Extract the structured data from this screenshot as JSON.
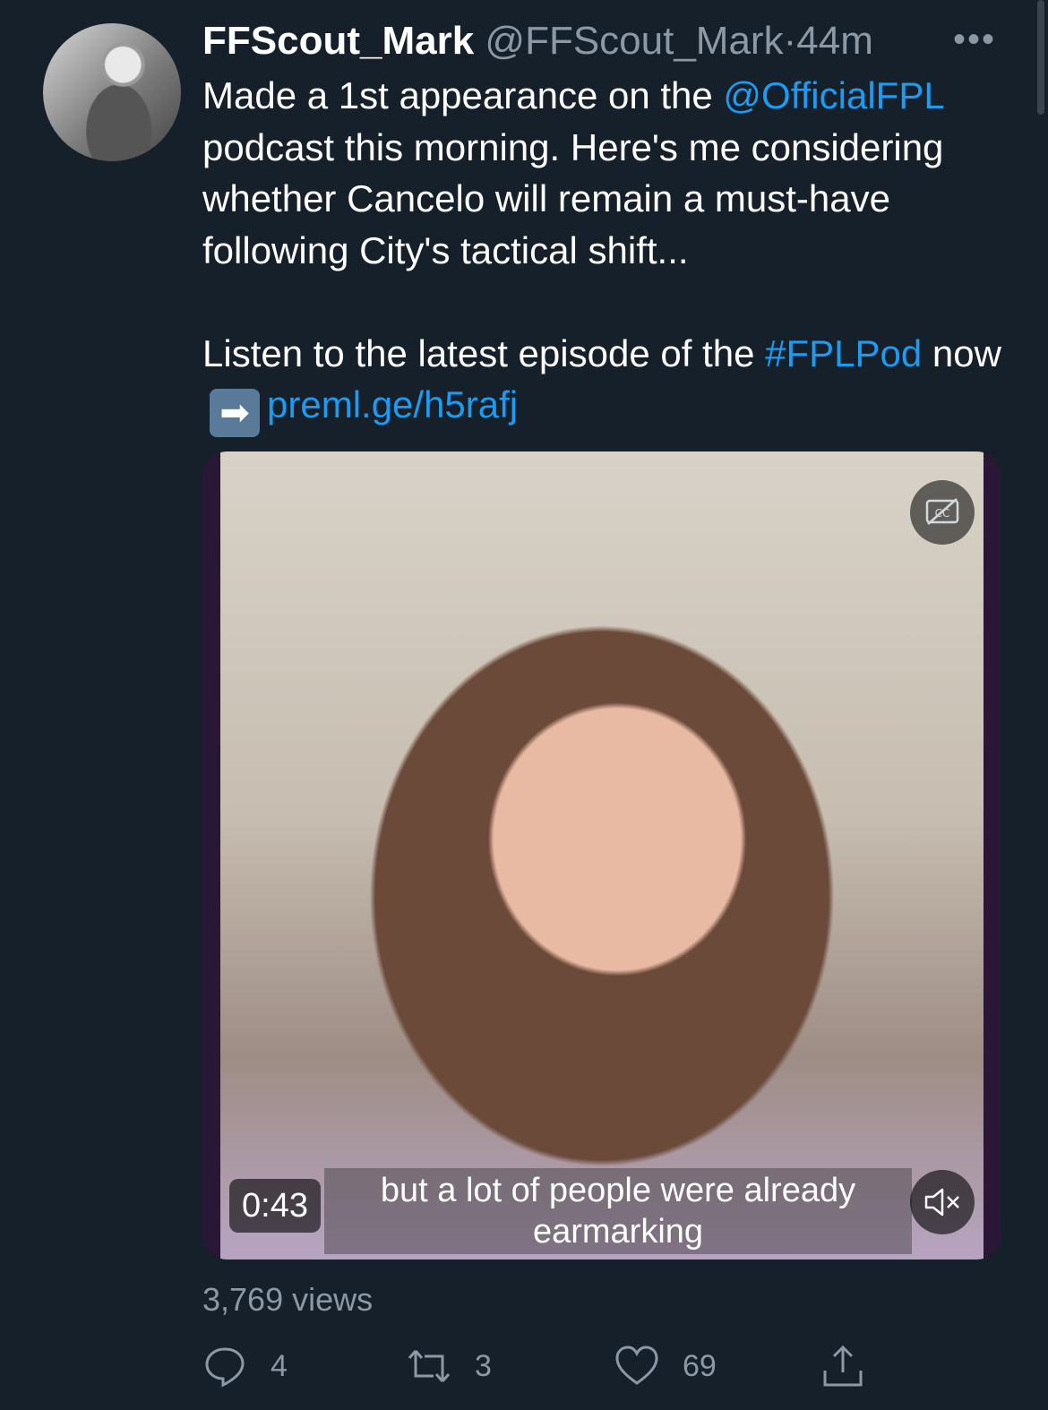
{
  "tweet": {
    "author_name": "FFScout_Mark",
    "handle": "@FFScout_Mark",
    "separator": "·",
    "time": "44m",
    "more_label": "•••",
    "text_line1_prefix": "Made a 1st appearance on the ",
    "mention": "@OfficialFPL",
    "text_line1_rest": " podcast this morning. Here's me considering whether Cancelo will remain a must-have following City's tactical shift...",
    "text_line2_prefix": "Listen to the latest episode of the ",
    "hashtag": "#FPLPod",
    "text_line2_now": " now",
    "arrow_emoji": "➡",
    "url": "preml.ge/h5rafj"
  },
  "media": {
    "timestamp": "0:43",
    "caption": "but a lot of people were already earmarking",
    "cc_icon": "cc-off-icon",
    "mute_icon": "muted-speaker-icon"
  },
  "stats": {
    "views": "3,769 views",
    "replies": "4",
    "retweets": "3",
    "likes": "69"
  },
  "colors": {
    "background": "#15202b",
    "link": "#1d9bf0",
    "muted": "#8b98a5"
  }
}
